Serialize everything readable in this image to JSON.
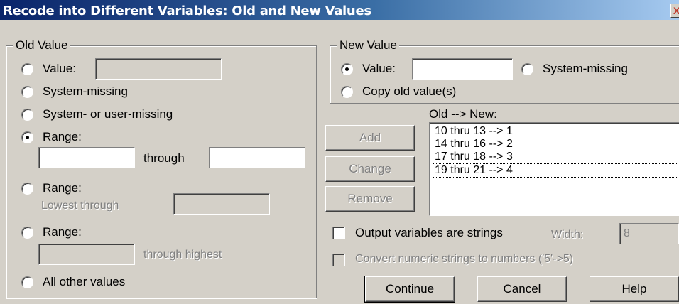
{
  "window": {
    "title": "Recode into Different Variables: Old and New Values",
    "close_glyph": "X"
  },
  "old_value": {
    "legend": "Old Value",
    "value_label": "Value:",
    "value_input": "",
    "system_missing_label": "System-missing",
    "sys_or_user_missing_label": "System- or user-missing",
    "range_label": "Range:",
    "range_from": "",
    "through_label": "through",
    "range_to": "",
    "range_lowest_label": "Range:",
    "lowest_through_label": "Lowest through",
    "lowest_through_input": "",
    "range_highest_label": "Range:",
    "highest_from_input": "",
    "through_highest_label": "through highest",
    "all_other_label": "All other values",
    "selected": "range"
  },
  "new_value": {
    "legend": "New Value",
    "value_label": "Value:",
    "value_input": "",
    "system_missing_label": "System-missing",
    "copy_old_label": "Copy old value(s)",
    "selected": "value"
  },
  "mapping": {
    "label": "Old --> New:",
    "items": [
      "10 thru 13 --> 1",
      "14 thru 16 --> 2",
      "17 thru 18 --> 3",
      "19 thru 21 --> 4"
    ],
    "focused_index": 3
  },
  "buttons": {
    "add": "Add",
    "change": "Change",
    "remove": "Remove",
    "continue": "Continue",
    "cancel": "Cancel",
    "help": "Help"
  },
  "options": {
    "output_strings_label": "Output variables are strings",
    "width_label": "Width:",
    "width_value": "8",
    "convert_label": "Convert numeric strings to numbers ('5'->5)"
  }
}
